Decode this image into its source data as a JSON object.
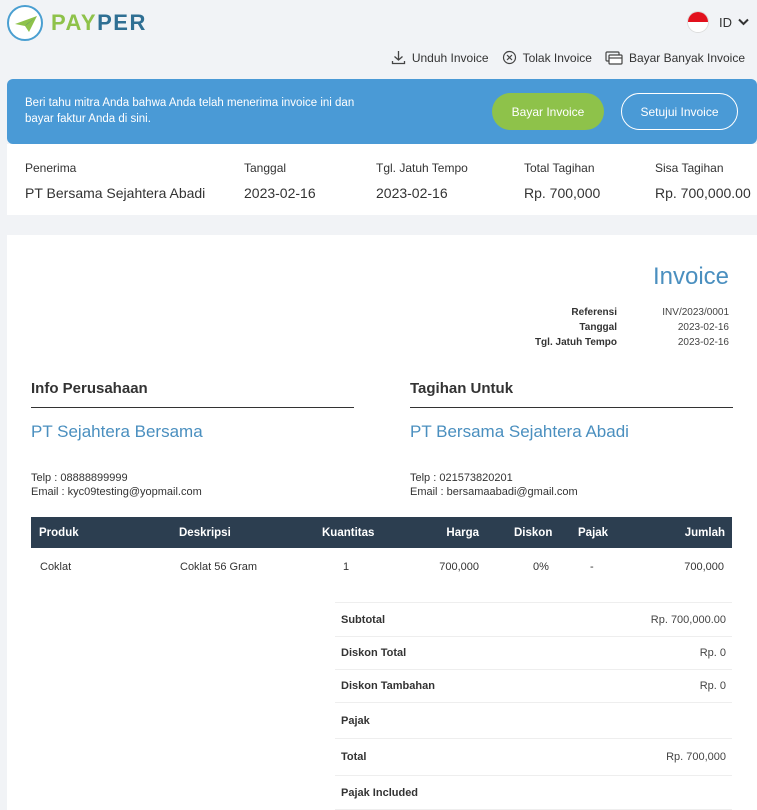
{
  "brand": {
    "pay": "PAY",
    "per": "PER"
  },
  "language": {
    "code": "ID"
  },
  "actions": [
    {
      "label": "Unduh Invoice",
      "icon": "download-icon"
    },
    {
      "label": "Tolak Invoice",
      "icon": "reject-icon"
    },
    {
      "label": "Bayar Banyak Invoice",
      "icon": "multi-payment-icon"
    }
  ],
  "banner": {
    "message": "Beri tahu mitra Anda bahwa Anda telah menerima invoice ini dan bayar faktur Anda di sini.",
    "pay_label": "Bayar Invoice",
    "approve_label": "Setujui Invoice"
  },
  "summary": {
    "recipient_label": "Penerima",
    "recipient": "PT Bersama Sejahtera Abadi",
    "date_label": "Tanggal",
    "date": "2023-02-16",
    "due_label": "Tgl. Jatuh Tempo",
    "due": "2023-02-16",
    "total_label": "Total Tagihan",
    "total": "Rp. 700,000",
    "remaining_label": "Sisa Tagihan",
    "remaining": "Rp. 700,000.00"
  },
  "invoice": {
    "title": "Invoice",
    "meta": [
      {
        "k": "Referensi",
        "v": "INV/2023/0001"
      },
      {
        "k": "Tanggal",
        "v": "2023-02-16"
      },
      {
        "k": "Tgl. Jatuh Tempo",
        "v": "2023-02-16"
      }
    ],
    "company": {
      "heading": "Info Perusahaan",
      "name": "PT Sejahtera Bersama",
      "telp": "Telp : 08888899999",
      "email": "Email : kyc09testing@yopmail.com"
    },
    "billto": {
      "heading": "Tagihan Untuk",
      "name": "PT Bersama Sejahtera Abadi",
      "telp": "Telp : 021573820201",
      "email": "Email : bersamaabadi@gmail.com"
    },
    "columns": [
      "Produk",
      "Deskripsi",
      "Kuantitas",
      "Harga",
      "Diskon",
      "Pajak",
      "Jumlah"
    ],
    "rows": [
      [
        "Coklat",
        "Coklat 56 Gram",
        "1",
        "700,000",
        "0%",
        "-",
        "700,000"
      ]
    ],
    "totals": [
      {
        "k": "Subtotal",
        "v": "Rp. 700,000.00"
      },
      {
        "k": "Diskon Total",
        "v": "Rp. 0"
      },
      {
        "k": "Diskon Tambahan",
        "v": "Rp. 0"
      },
      {
        "k": "Pajak",
        "v": ""
      },
      {
        "k": "Total",
        "v": "Rp. 700,000"
      },
      {
        "k": "Pajak Included",
        "v": ""
      }
    ]
  },
  "colors": {
    "accent": "#4a9ad6",
    "pay_button": "#8ec24a",
    "table_header": "#2c3e50",
    "title_blue": "#4a8fbf"
  }
}
